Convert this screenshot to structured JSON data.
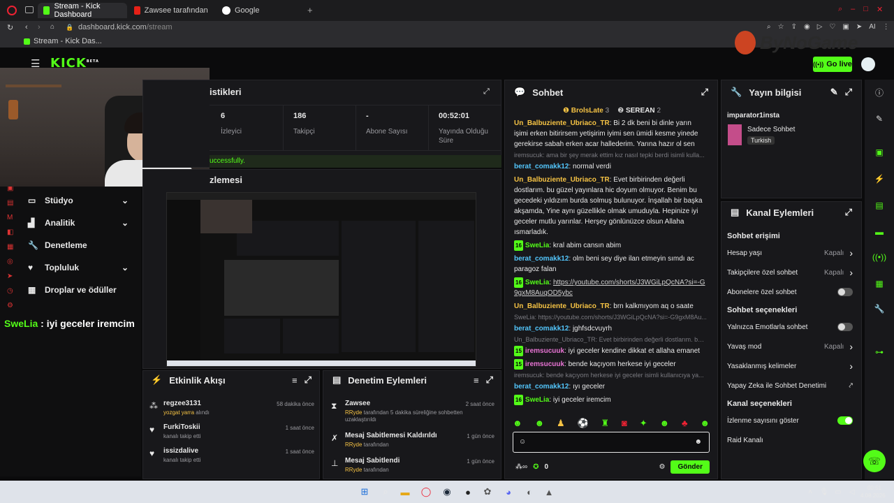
{
  "browser": {
    "tabs": [
      {
        "label": "Stream - Kick Dashboard"
      },
      {
        "label": "Zawsee tarafından paylaşı"
      },
      {
        "label": "Google"
      }
    ],
    "url_host": "dashboard.kick.com",
    "url_path": "/stream",
    "bookmark": "Stream - Kick Das..."
  },
  "header": {
    "logo": "KICK",
    "logo_sup": "BETA",
    "go_live": "Go live",
    "watermark": "ByNoGame"
  },
  "sidebar": {
    "items": [
      {
        "label": "Stüdyo",
        "chevron": true
      },
      {
        "label": "Analitik",
        "chevron": true
      },
      {
        "label": "Denetleme",
        "chevron": false
      },
      {
        "label": "Topluluk",
        "chevron": true
      },
      {
        "label": "Droplar ve ödüller",
        "chevron": false
      }
    ],
    "overlay_chat": {
      "user": "SweLia",
      "text": " : iyi geceler iremcim"
    }
  },
  "stats": {
    "title": "İstatistikleri",
    "title_visible": "istikleri",
    "cells": [
      {
        "value": "6",
        "label": "İzleyici"
      },
      {
        "value": "186",
        "label": "Takipçi"
      },
      {
        "value": "-",
        "label": "Abone Sayısı"
      },
      {
        "value": "00:52:01",
        "label": "Yayında Olduğu Süre"
      }
    ],
    "success_text": "uccessfully."
  },
  "preview": {
    "title_visible": "zlemesi"
  },
  "activity": {
    "title": "Etkinlik Akışı",
    "items": [
      {
        "user": "regzee3131",
        "sub": "yozgat yarra",
        "sub2": " alındı",
        "time": "58 dakika önce"
      },
      {
        "user": "FurkiToskii",
        "sub": "kanalı takip etti",
        "sub2": "",
        "time": "1 saat önce"
      },
      {
        "user": "issizdalive",
        "sub": "kanalı takip etti",
        "sub2": "",
        "time": "1 saat önce"
      }
    ]
  },
  "moderation": {
    "title": "Denetim Eylemleri",
    "items": [
      {
        "title": "Zawsee",
        "by": "RRyde",
        "text": " tarafından 5 dakika süreliğine sohbetten uzaklaştırıldı",
        "time": "2 saat önce"
      },
      {
        "title": "Mesaj Sabitlemesi Kaldırıldı",
        "by": "RRyde",
        "text": " tarafından",
        "time": "1 gün önce"
      },
      {
        "title": "Mesaj Sabitlendi",
        "by": "RRyde",
        "text": " tarafından",
        "time": "1 gün önce"
      }
    ]
  },
  "chat": {
    "title": "Sohbet",
    "top_users": [
      {
        "name": "BrolsLate",
        "count": "3"
      },
      {
        "name": "SEREAN",
        "count": "2"
      }
    ],
    "messages": [
      {
        "type": "msg",
        "user": "Un_Balbuziente_Ubriaco_TR",
        "color": "y",
        "text": ": Bi 2 dk beni bi dinle yarın işimi erken bitirirsem yetişirim iyimi sen ümidi kesme yinede gerekirse sabah erken acar hallederim. Yarına hazır ol sen"
      },
      {
        "type": "reply",
        "text": "iremsucuk: ama bir şey merak ettim kız nasıl tepki berdi isimli kulla..."
      },
      {
        "type": "msg",
        "user": "berat_comakk12",
        "color": "c",
        "text": ": normal verdi"
      },
      {
        "type": "msg",
        "user": "Un_Balbuziente_Ubriaco_TR",
        "color": "y",
        "text": ": Evet birbirinden değerli dostlarım. bu güzel yayınlara hic doyum olmuyor. Benim bu gecedeki yıldızım burda solmuş bulunuyor. İnşallah bir başka akşamda, Yine aynı güzellikle olmak umuduyla. Hepinize iyi geceler mutlu yarınlar. Herşey gönlünüzce olsun Allaha ısmarladık."
      },
      {
        "type": "msg",
        "badge": "16",
        "user": "SweLia",
        "color": "g",
        "text": ": kral abim cansın abim"
      },
      {
        "type": "msg",
        "user": "berat_comakk12",
        "color": "c",
        "text": ": olm beni sey diye ilan etmeyin sımdı ac paragoz falan"
      },
      {
        "type": "msg",
        "badge": "16",
        "user": "SweLia",
        "color": "g",
        "link": "https://youtube.com/shorts/J3WGiLpQcNA?si=-G9gxM8AuqOD5ybc"
      },
      {
        "type": "msg",
        "user": "Un_Balbuziente_Ubriaco_TR",
        "color": "y",
        "text": ": brn kalkmıyom aq o saate"
      },
      {
        "type": "reply",
        "text": "SweLia: https://youtube.com/shorts/J3WGiLpQcNA?si=-G9gxM8Au..."
      },
      {
        "type": "msg",
        "user": "berat_comakk12",
        "color": "c",
        "text": ": jghfsdcvuyrh"
      },
      {
        "type": "reply",
        "text": "Un_Balbuziente_Ubriaco_TR: Evet birbirinden değerli dostlarım. bu g..."
      },
      {
        "type": "msg",
        "badge": "15",
        "user": "iremsucuuk",
        "color": "p",
        "text": ": iyi geceler kendine dikkat et allaha emanet"
      },
      {
        "type": "msg",
        "badge": "15",
        "user": "iremsucuuk",
        "color": "p",
        "text": ": bende kaçıyom herkese iyi geceler"
      },
      {
        "type": "reply",
        "text": "iremsucuk: bende kaçıyom herkese iyi geceler isimli kullanıcıya ya..."
      },
      {
        "type": "msg",
        "user": "berat_comakk12",
        "color": "c",
        "text": ": ıyı geceler"
      },
      {
        "type": "msg",
        "badge": "16",
        "user": "SweLia",
        "color": "g",
        "text": ": iyi geceler iremcim"
      }
    ],
    "input_placeholder": "",
    "send": "Gönder",
    "points": "0"
  },
  "stream_info": {
    "title": "Yayın bilgisi",
    "stream_title": "imparator1insta",
    "category": "Sadece Sohbet",
    "tag": "Turkish"
  },
  "channel_actions": {
    "title": "Kanal Eylemleri",
    "sections": [
      {
        "heading": "Sohbet erişimi",
        "rows": [
          {
            "label": "Hesap yaşı",
            "value": "Kapalı",
            "ctrl": "chev"
          },
          {
            "label": "Takipçilere özel sohbet",
            "value": "Kapalı",
            "ctrl": "chev"
          },
          {
            "label": "Abonelere özel sohbet",
            "value": "",
            "ctrl": "toggle-off"
          }
        ]
      },
      {
        "heading": "Sohbet seçenekleri",
        "rows": [
          {
            "label": "Yalnızca Emotlarla sohbet",
            "value": "",
            "ctrl": "toggle-off"
          },
          {
            "label": "Yavaş mod",
            "value": "Kapalı",
            "ctrl": "chev"
          },
          {
            "label": "Yasaklanmış kelimeler",
            "value": "",
            "ctrl": "chev"
          },
          {
            "label": "Yapay Zeka ile Sohbet Denetimi",
            "value": "",
            "ctrl": "ext"
          }
        ]
      },
      {
        "heading": "Kanal seçenekleri",
        "rows": [
          {
            "label": "İzlenme sayısını göster",
            "value": "",
            "ctrl": "toggle-on"
          },
          {
            "label": "Raid Kanalı",
            "value": "",
            "ctrl": "none"
          }
        ]
      }
    ]
  },
  "taskbar": {
    "time": "00:51",
    "date": "4.08.2026"
  },
  "colors": {
    "accent": "#53fc18",
    "panel": "#18181b",
    "bg": "#0b0b0c"
  }
}
